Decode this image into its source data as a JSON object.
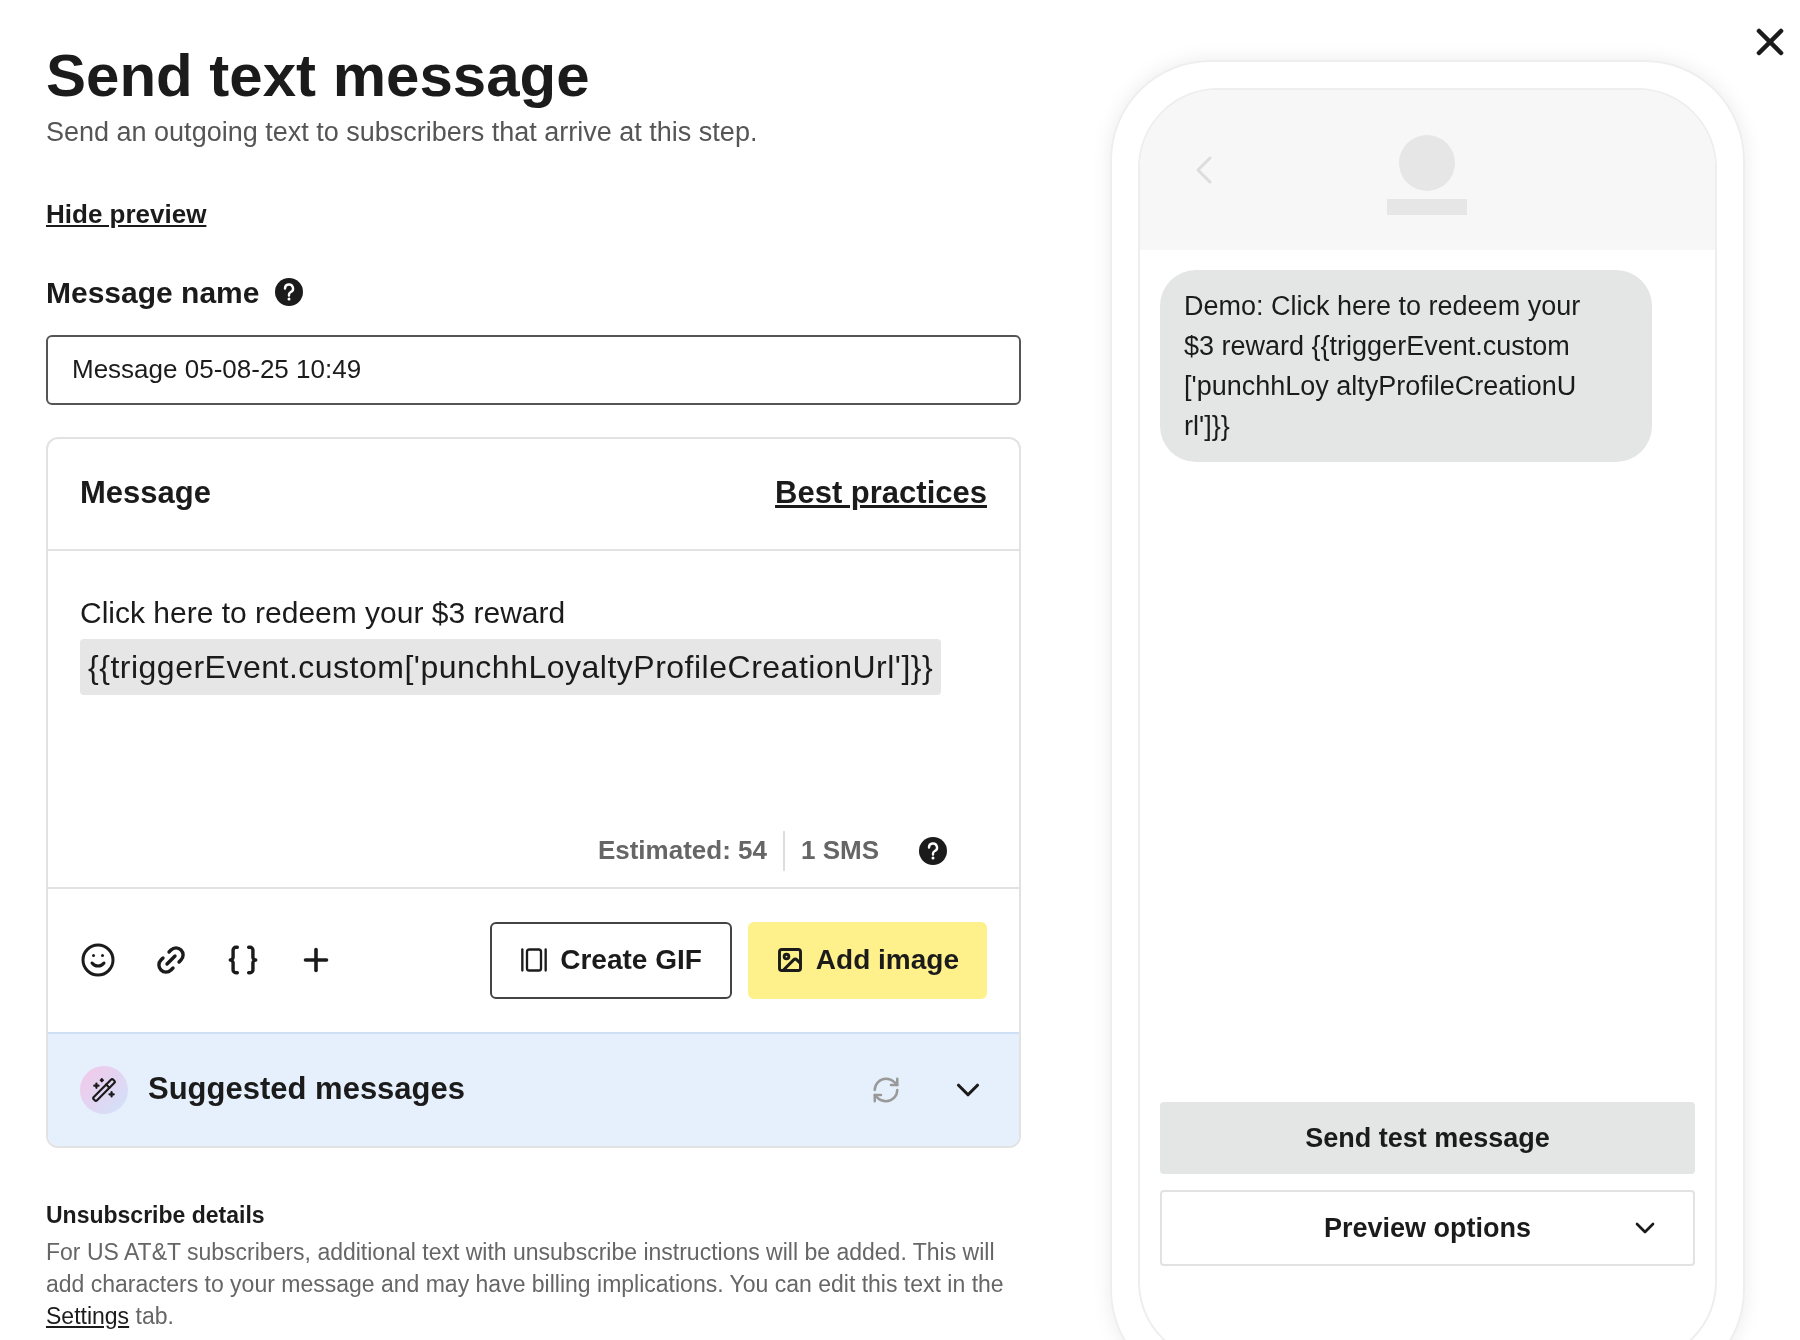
{
  "header": {
    "title": "Send text message",
    "subtitle": "Send an outgoing text to subscribers that arrive at this step."
  },
  "preview_toggle": "Hide preview",
  "message_name": {
    "label": "Message name",
    "value": "Message 05-08-25 10:49"
  },
  "message": {
    "title": "Message",
    "best_practices": "Best practices",
    "text": "Click here to redeem your $3 reward",
    "token": "{{triggerEvent.custom['punchhLoyaltyProfileCreationUrl']}}",
    "estimated": "Estimated: 54",
    "segments": "1 SMS"
  },
  "toolbar": {
    "buttons": [
      {
        "label": "Create GIF",
        "kind": "outline"
      },
      {
        "label": "Add image",
        "kind": "primary"
      }
    ]
  },
  "suggested": {
    "label": "Suggested messages",
    "expanded": false
  },
  "unsubscribe": {
    "title": "Unsubscribe details",
    "text_before": "For US AT&T subscribers, additional text with unsubscribe instructions will be added. This will add characters to your message and may have billing implications. You can edit this text in the",
    "link": "Settings",
    "text_after": "tab."
  },
  "preview": {
    "bubble": "Demo: Click here to redeem your $3 reward {{triggerEvent.custom['punchhLoy altyProfileCreationUrl']}}",
    "send_test": "Send test message",
    "options": "Preview options"
  }
}
